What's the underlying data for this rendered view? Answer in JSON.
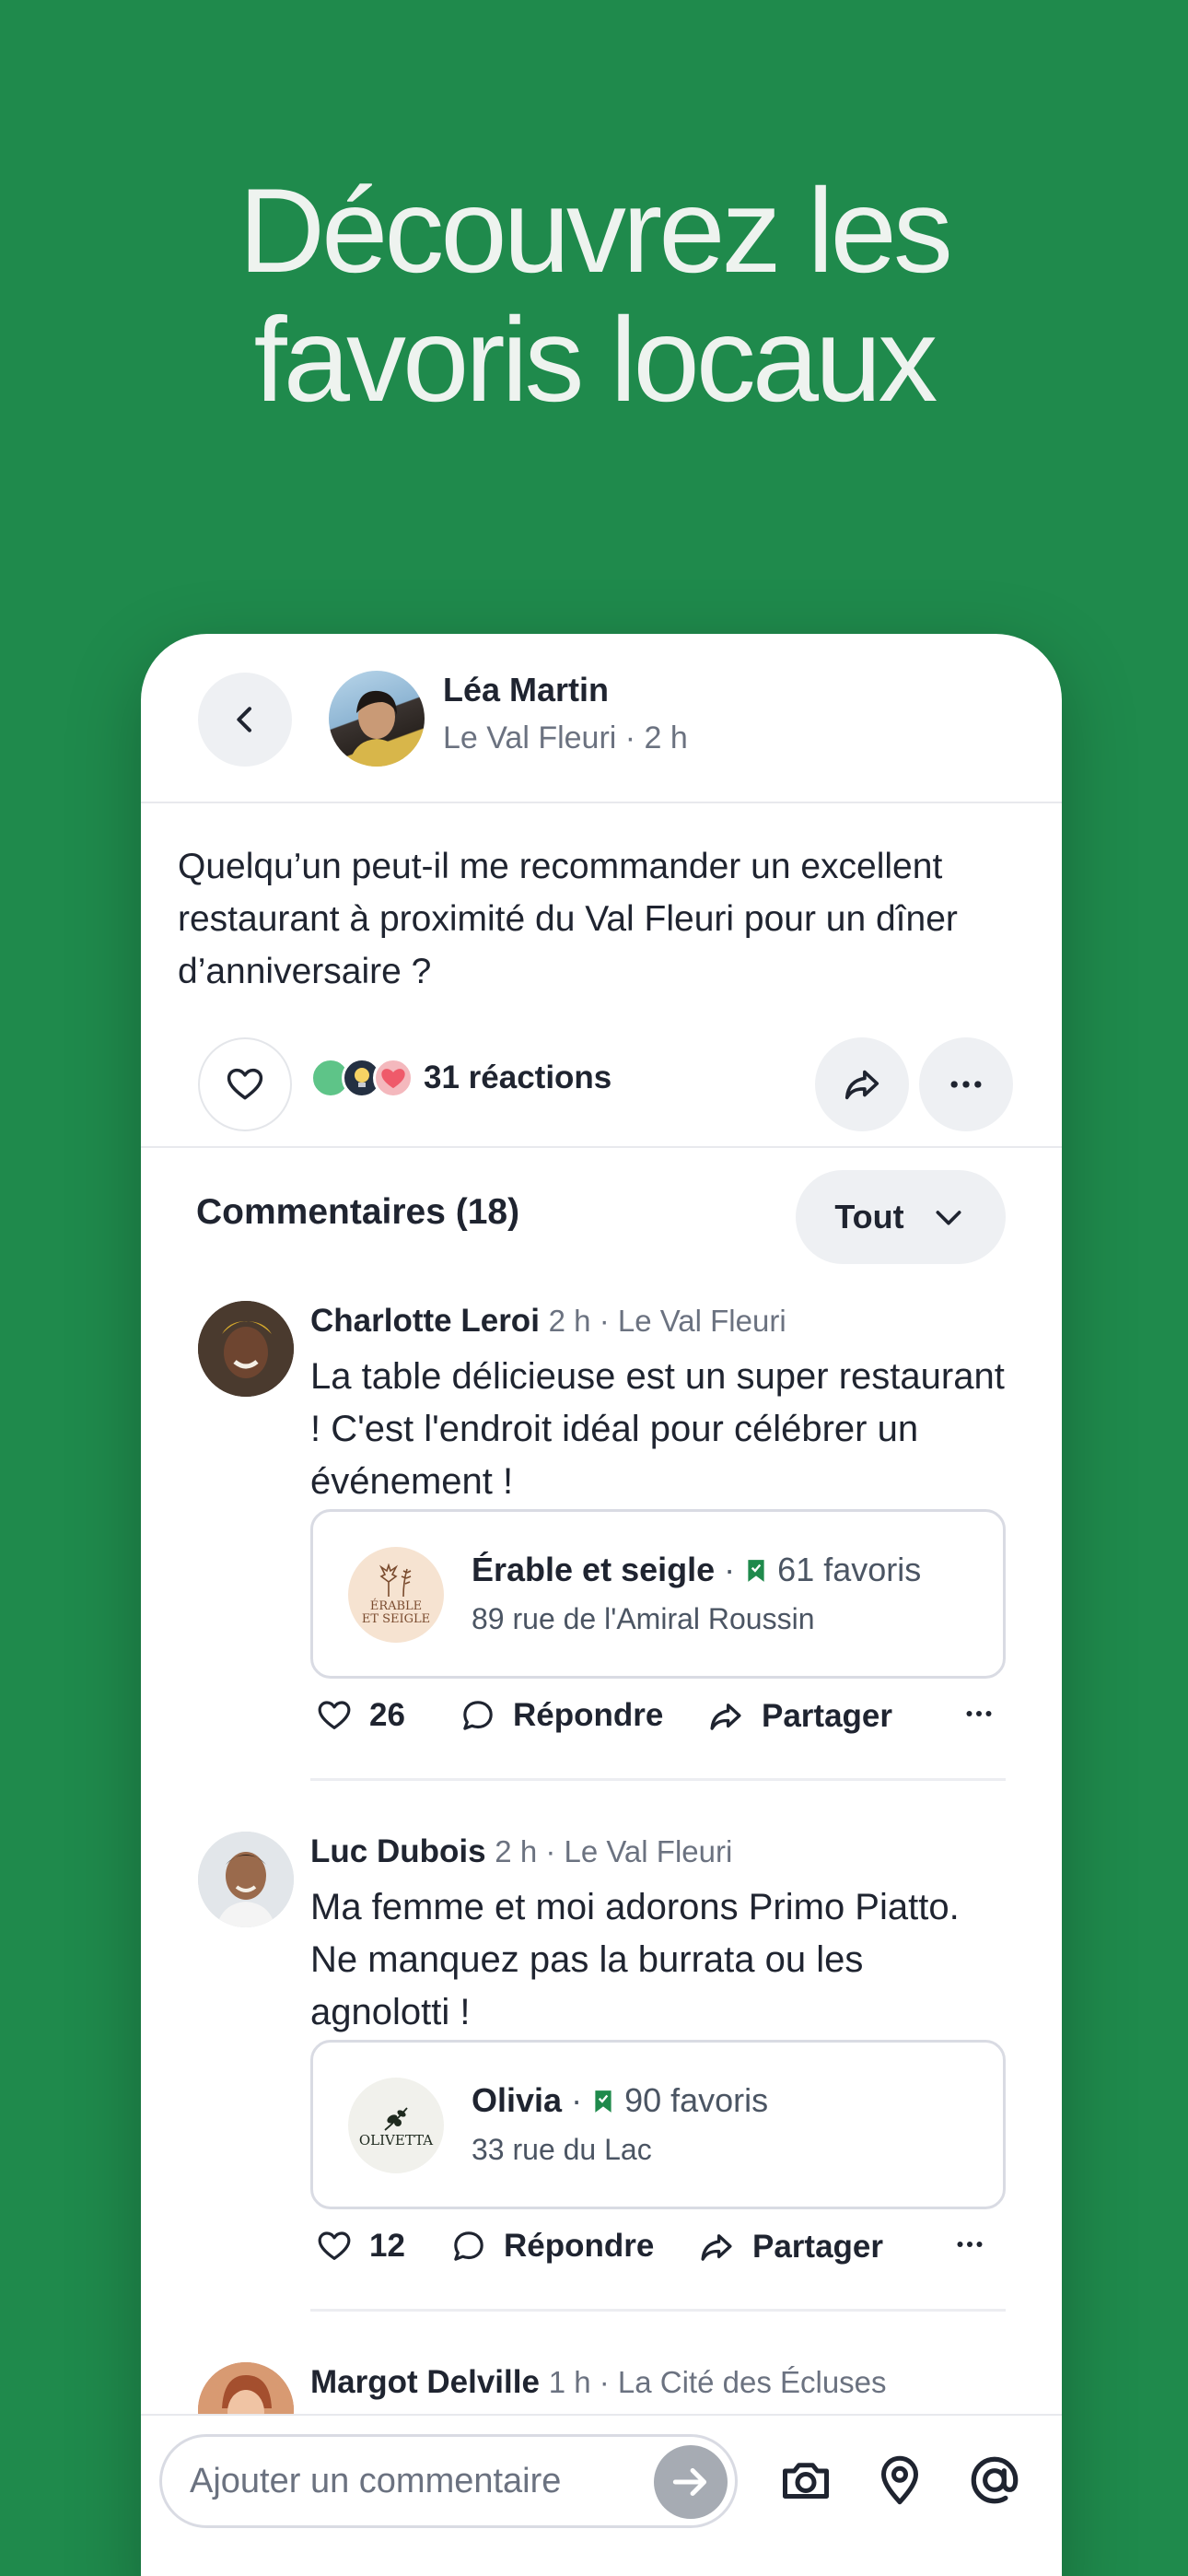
{
  "hero": {
    "line1": "Découvrez les",
    "line2": "favoris locaux"
  },
  "post": {
    "author": "Léa Martin",
    "meta": "Le Val Fleuri · 2 h",
    "text": "Quelqu’un peut-il me recommander un excellent restaurant à proximité du Val Fleuri pour un dîner d’anniversaire ?",
    "reactions_label": "31 réactions"
  },
  "comments_header": {
    "title": "Commentaires (18)",
    "filter": "Tout"
  },
  "comments": [
    {
      "name": "Charlotte Leroi",
      "meta": "2 h · Le Val Fleuri",
      "text": "La table délicieuse est un super restaurant ! C'est l'endroit idéal pour célébrer un événement !",
      "place": {
        "name": "Érable et seigle",
        "favorites": "61 favoris",
        "address": "89 rue de l'Amiral Roussin",
        "logo_line1": "ÉRABLE",
        "logo_line2": "ET SEIGLE"
      },
      "likes": "26",
      "reply": "Répondre",
      "share": "Partager"
    },
    {
      "name": "Luc Dubois",
      "meta": "2 h · Le Val Fleuri",
      "text": "Ma femme et moi adorons Primo Piatto. Ne manquez pas la burrata ou les agnolotti !",
      "place": {
        "name": "Olivia",
        "favorites": "90 favoris",
        "address": "33 rue du Lac",
        "logo_line1": "OLIVETTA"
      },
      "likes": "12",
      "reply": "Répondre",
      "share": "Partager"
    },
    {
      "name": "Margot Delville",
      "meta": "1 h · La Cité des Écluses"
    }
  ],
  "composer": {
    "placeholder": "Ajouter un commentaire"
  },
  "icons": {
    "back": "chevron-left-icon",
    "heart": "heart-icon",
    "share": "share-icon",
    "more": "more-icon",
    "chevron": "chevron-down-icon",
    "comment": "comment-icon",
    "camera": "camera-icon",
    "location": "location-pin-icon",
    "mention": "at-icon",
    "send": "arrow-right-icon",
    "favorite": "bookmark-icon"
  },
  "colors": {
    "brand_green": "#1f8a4c",
    "text": "#1f2430",
    "muted": "#6b7280"
  }
}
